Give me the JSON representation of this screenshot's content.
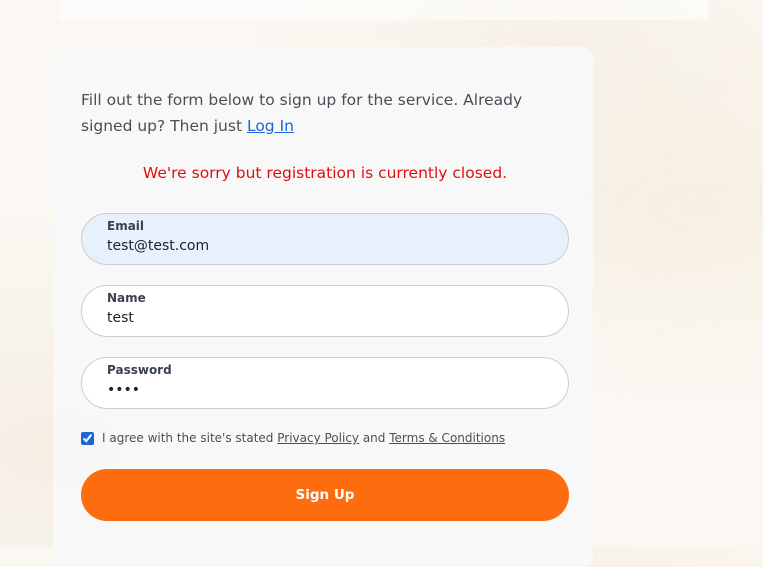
{
  "intro": {
    "text": "Fill out the form below to sign up for the service. Already signed up? Then just ",
    "login_link": "Log In"
  },
  "error_message": "We're sorry but registration is currently closed.",
  "fields": {
    "email": {
      "label": "Email",
      "value": "test@test.com"
    },
    "name": {
      "label": "Name",
      "value": "test"
    },
    "password": {
      "label": "Password",
      "value": "test"
    }
  },
  "agree": {
    "checked": true,
    "prefix": "I agree with the site's stated ",
    "privacy_link": "Privacy Policy",
    "and": " and ",
    "terms_link": "Terms & Conditions"
  },
  "signup_button": "Sign Up",
  "colors": {
    "accent": "#fd6c0f",
    "error": "#e00f0f",
    "link": "#1a66d4"
  }
}
